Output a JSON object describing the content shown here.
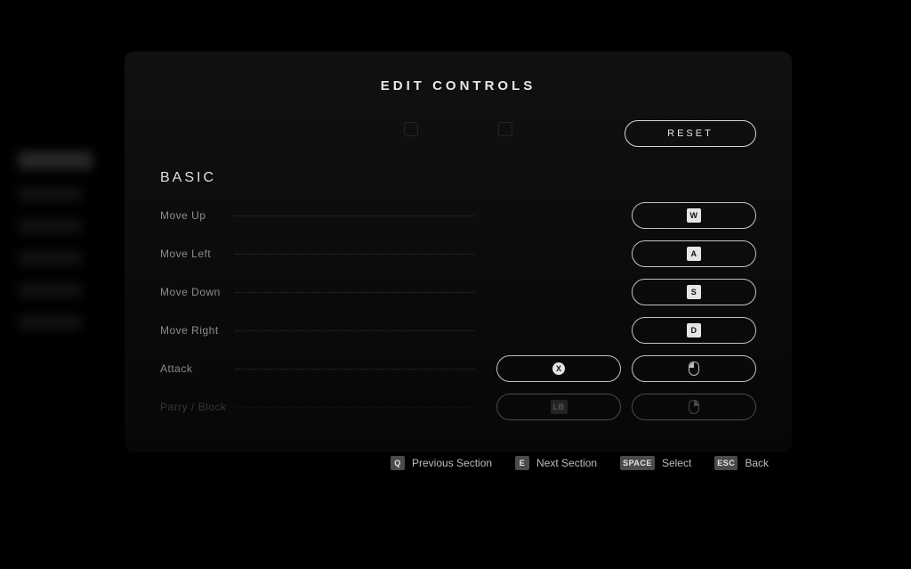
{
  "title": "EDIT CONTROLS",
  "reset_label": "RESET",
  "section": {
    "name": "BASIC",
    "rows": [
      {
        "label": "Move Up",
        "slot1": null,
        "slot2": {
          "kind": "key",
          "text": "W"
        }
      },
      {
        "label": "Move Left",
        "slot1": null,
        "slot2": {
          "kind": "key",
          "text": "A"
        }
      },
      {
        "label": "Move Down",
        "slot1": null,
        "slot2": {
          "kind": "key",
          "text": "S"
        }
      },
      {
        "label": "Move Right",
        "slot1": null,
        "slot2": {
          "kind": "key",
          "text": "D"
        }
      },
      {
        "label": "Attack",
        "slot1": {
          "kind": "xbtn",
          "text": "X"
        },
        "slot2": {
          "kind": "mouseL"
        }
      },
      {
        "label": "Parry / Block",
        "slot1": {
          "kind": "lb",
          "text": "LB"
        },
        "slot2": {
          "kind": "mouseR"
        },
        "faded": true
      }
    ]
  },
  "footer": {
    "prev": {
      "key": "Q",
      "label": "Previous Section"
    },
    "next": {
      "key": "E",
      "label": "Next Section"
    },
    "select": {
      "key": "SPACE",
      "label": "Select"
    },
    "back": {
      "key": "ESC",
      "label": "Back"
    }
  }
}
